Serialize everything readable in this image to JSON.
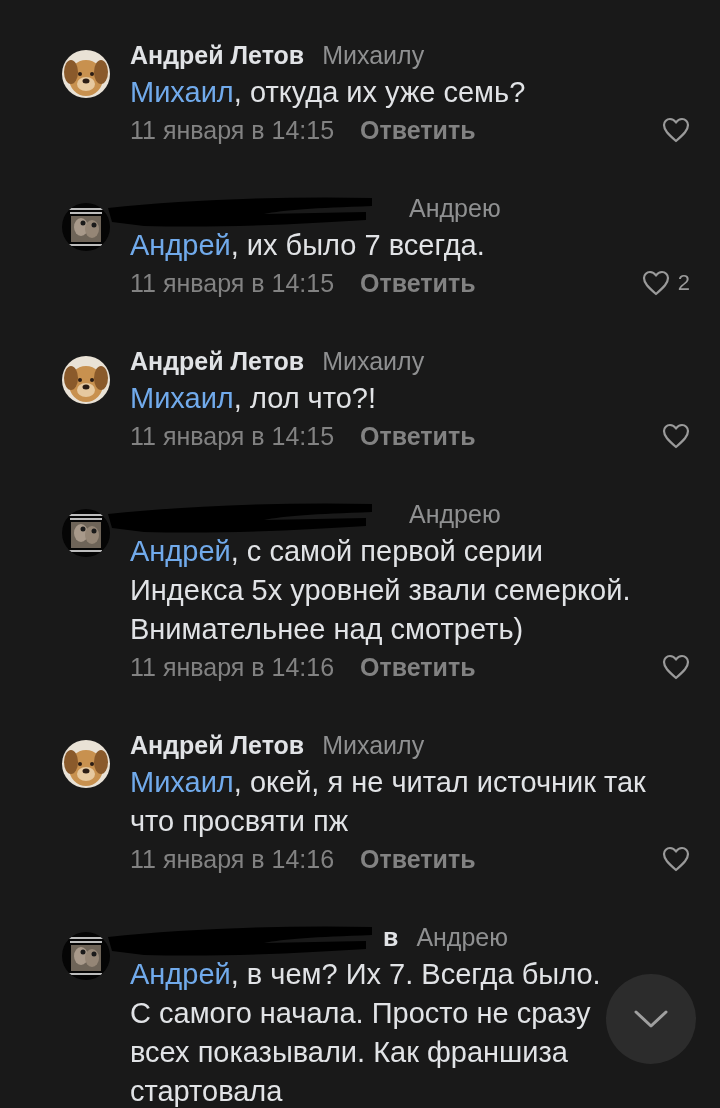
{
  "comments": [
    {
      "author": {
        "redacted": false,
        "name": "Андрей Летов"
      },
      "reply_to": "Михаилу",
      "mention": "Михаил",
      "text": ", откуда их уже семь?",
      "date": "11 января в 14:15",
      "reply_label": "Ответить"
    },
    {
      "author": {
        "redacted": true
      },
      "reply_to": "Андрею",
      "mention": "Андрей",
      "text": ", их было 7 всегда.",
      "date": "11 января в 14:15",
      "reply_label": "Ответить",
      "likes": "2"
    },
    {
      "author": {
        "redacted": false,
        "name": "Андрей Летов"
      },
      "reply_to": "Михаилу",
      "mention": "Михаил",
      "text": ", лол что?!",
      "date": "11 января в 14:15",
      "reply_label": "Ответить"
    },
    {
      "author": {
        "redacted": true
      },
      "reply_to": "Андрею",
      "mention": "Андрей",
      "text": ", с самой первой серии Индекса 5х уровней звали семеркой. Внимательнее над смотреть)",
      "date": "11 января в 14:16",
      "reply_label": "Ответить"
    },
    {
      "author": {
        "redacted": false,
        "name": "Андрей Летов"
      },
      "reply_to": "Михаилу",
      "mention": "Михаил",
      "text": ", окей, я не читал источник так что просвяти пж",
      "date": "11 января в 14:16",
      "reply_label": "Ответить"
    },
    {
      "author": {
        "redacted": true,
        "name_fragment": "в"
      },
      "reply_to": "Андрею",
      "mention": "Андрей",
      "text": ", в чем? Их 7. Всегда было.\nС самого начала. Просто не сразу всех показывали. Как франшиза стартовала"
    }
  ]
}
